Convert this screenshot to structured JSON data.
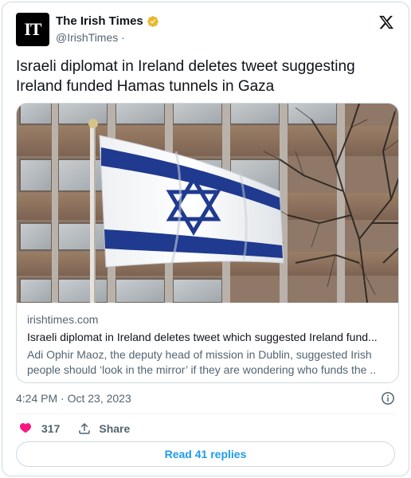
{
  "author": {
    "avatar_text": "IT",
    "name": "The Irish Times",
    "handle": "@IrishTimes",
    "handle_separator": "·",
    "verified_badge_color": "#e8b829"
  },
  "tweet": {
    "text": "Israeli diplomat in Ireland deletes tweet suggesting Ireland funded Hamas tunnels in Gaza"
  },
  "link_card": {
    "domain": "irishtimes.com",
    "title": "Israeli diplomat in Ireland deletes tweet which suggested Ireland fund...",
    "description": "Adi Ophir Maoz, the deputy head of mission in Dublin, suggested Irish people should ‘look in the mirror’ if they are wondering who funds the ..",
    "image_subject": "israeli-flag-photo"
  },
  "timestamp": "4:24 PM · Oct 23, 2023",
  "actions": {
    "like_count": "317",
    "share_label": "Share"
  },
  "read_replies_label": "Read 41 replies",
  "colors": {
    "like": "#f91880",
    "link_blue": "#1d9bf0",
    "secondary_text": "#536471"
  }
}
